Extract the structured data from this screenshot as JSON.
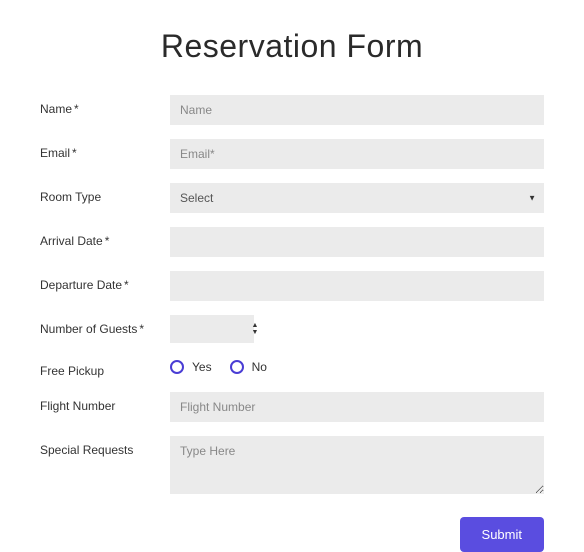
{
  "title": "Reservation Form",
  "fields": {
    "name": {
      "label": "Name",
      "required": "*",
      "placeholder": "Name"
    },
    "email": {
      "label": "Email",
      "required": "*",
      "placeholder": "Email*"
    },
    "roomType": {
      "label": "Room Type",
      "selected": "Select"
    },
    "arrival": {
      "label": "Arrival Date",
      "required": "*"
    },
    "departure": {
      "label": "Departure Date",
      "required": "*"
    },
    "guests": {
      "label": "Number of Guests",
      "required": "*"
    },
    "pickup": {
      "label": "Free Pickup",
      "options": {
        "yes": "Yes",
        "no": "No"
      }
    },
    "flight": {
      "label": "Flight Number",
      "placeholder": "Flight Number"
    },
    "special": {
      "label": "Special Requests",
      "placeholder": "Type Here"
    }
  },
  "submit": {
    "label": "Submit"
  }
}
